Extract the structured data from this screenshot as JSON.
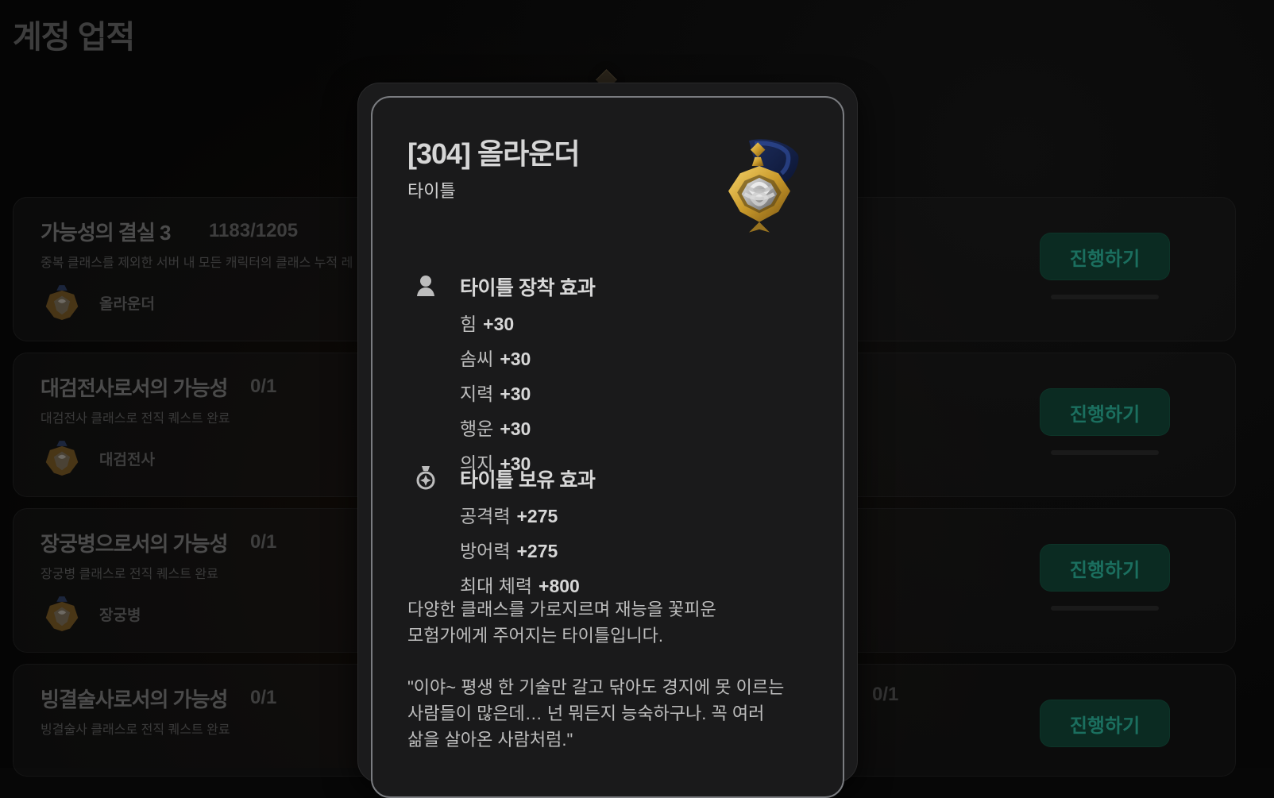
{
  "page": {
    "title": "계정 업적"
  },
  "achievements": [
    {
      "title": "가능성의 결실 3",
      "progress": "1183/1205",
      "desc": "중복 클래스를 제외한 서버 내 모든 캐릭터의 클래스 누적 레",
      "reward_name": "올라운더",
      "button_label": "진행하기"
    },
    {
      "title": "대검전사로서의 가능성",
      "progress": "0/1",
      "desc": "대검전사 클래스로 전직 퀘스트 완료",
      "reward_name": "대검전사",
      "button_label": "진행하기"
    },
    {
      "title": "장궁병으로서의 가능성",
      "progress": "0/1",
      "desc": "장궁병 클래스로 전직 퀘스트 완료",
      "reward_name": "장궁병",
      "button_label": "진행하기"
    },
    {
      "title": "빙결술사로서의 가능성",
      "progress": "0/1",
      "desc": "빙결술사 클래스로 전직 퀘스트 완료",
      "reward_name": "",
      "button_label": "진행하기",
      "right_partial": "0/1"
    }
  ],
  "popover": {
    "title": "[304] 올라운더",
    "subtitle": "타이틀",
    "equip": {
      "title": "타이틀 장착 효과",
      "icon": "person-icon",
      "lines": [
        {
          "k": "힘",
          "v": "+30"
        },
        {
          "k": "솜씨",
          "v": "+30"
        },
        {
          "k": "지력",
          "v": "+30"
        },
        {
          "k": "행운",
          "v": "+30"
        },
        {
          "k": "의지",
          "v": "+30"
        }
      ]
    },
    "own": {
      "title": "타이틀 보유 효과",
      "icon": "medal-icon",
      "lines": [
        {
          "k": "공격력",
          "v": "+275"
        },
        {
          "k": "방어력",
          "v": "+275"
        },
        {
          "k": "최대 체력",
          "v": "+800"
        }
      ]
    },
    "description": "다양한 클래스를 가로지르며 재능을 꽃피운\n모험가에게 주어지는 타이틀입니다.",
    "quote": "\"이야~ 평생 한 기술만 갈고 닦아도 경지에 못 이르는\n사람들이 많은데… 넌 뭐든지 능숙하구나. 꼭 여러\n삶을 살아온 사람처럼.\""
  },
  "colors": {
    "accent_green": "#1b6f5f"
  }
}
